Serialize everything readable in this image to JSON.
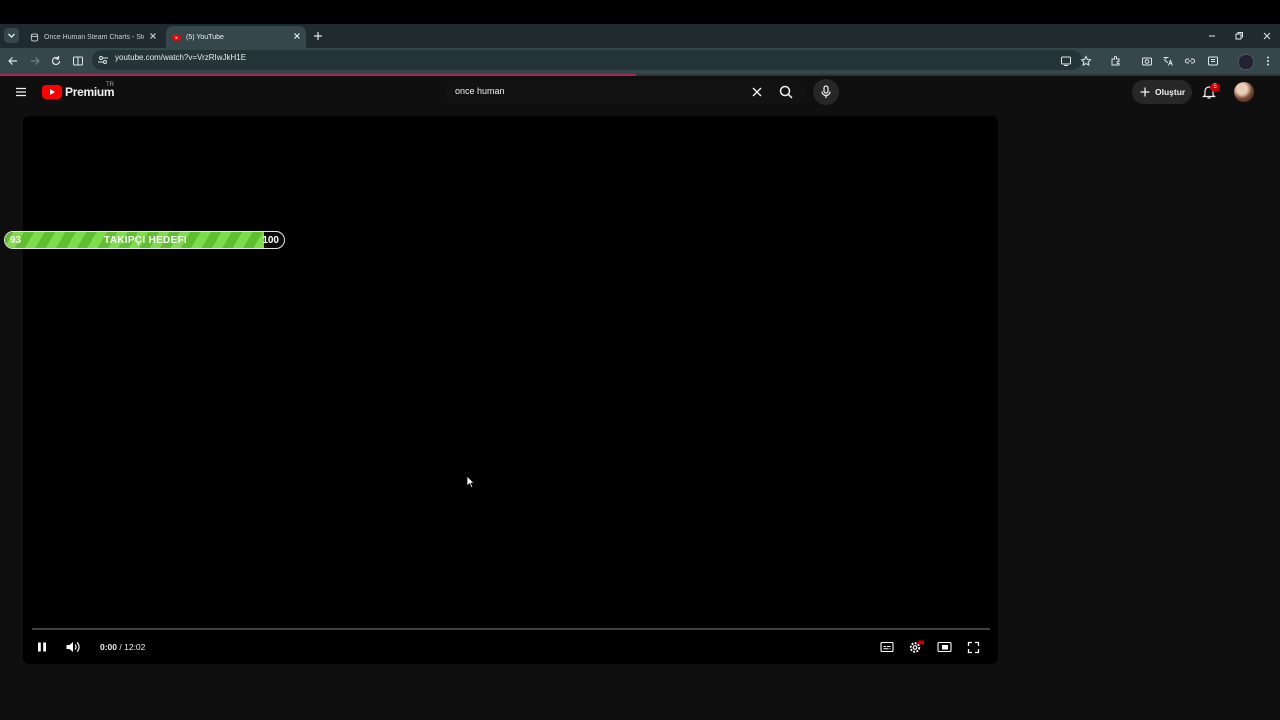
{
  "browser": {
    "tabs": [
      {
        "title": "Once Human Steam Charts - Ste",
        "active": false
      },
      {
        "title": "(5) YouTube",
        "active": true
      }
    ],
    "url": "youtube.com/watch?v=VrzRIwJkH1E"
  },
  "youtube": {
    "logo_label": "Premium",
    "region": "TR",
    "search_value": "once human",
    "create_label": "Oluştur",
    "notification_count": "5"
  },
  "player": {
    "current_time": "0:00",
    "duration": "12:02",
    "time_separator": " / ",
    "progress": 0.0
  },
  "overlay": {
    "start_value": "93",
    "title": "TAKIPÇI HEDEFI",
    "end_value": "100",
    "fill_fraction": 0.93
  },
  "colors": {
    "accent": "#ff0000",
    "goal_fill": "#6fce3e",
    "chrome_active": "#35474b"
  }
}
